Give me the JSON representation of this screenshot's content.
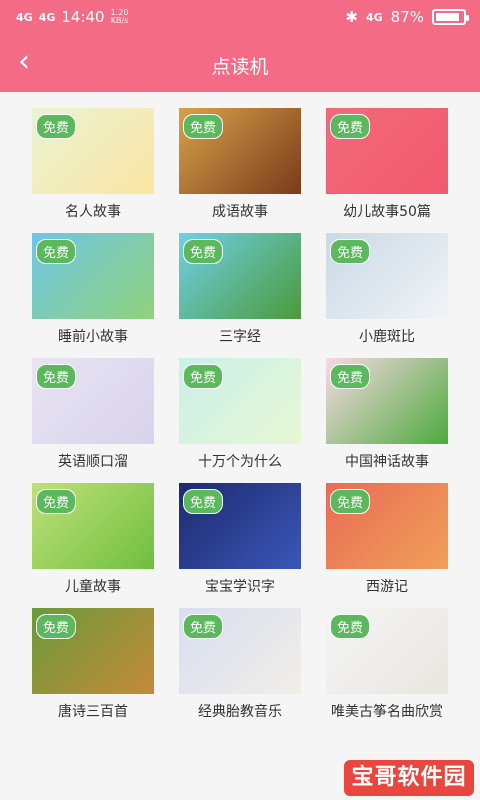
{
  "status_bar": {
    "network1": "4G",
    "network2": "4G",
    "time": "14:40",
    "speed_value": "1.20",
    "speed_unit": "KB/s",
    "network_right": "4G",
    "battery_text": "87%",
    "battery_level": 0.87
  },
  "nav": {
    "title": "点读机",
    "back_icon": "chevron-left-icon"
  },
  "items": [
    {
      "badge": "免费",
      "label": "名人故事",
      "bg1": "#eaf3d4",
      "bg2": "#fbe6a2"
    },
    {
      "badge": "免费",
      "label": "成语故事",
      "bg1": "#d8a24a",
      "bg2": "#7a3a1a"
    },
    {
      "badge": "免费",
      "label": "幼儿故事50篇",
      "bg1": "#f16a7a",
      "bg2": "#f25a6e"
    },
    {
      "badge": "免费",
      "label": "睡前小故事",
      "bg1": "#6fc5e6",
      "bg2": "#8fd27a"
    },
    {
      "badge": "免费",
      "label": "三字经",
      "bg1": "#6fd0e8",
      "bg2": "#4b9a3a"
    },
    {
      "badge": "免费",
      "label": "小鹿斑比",
      "bg1": "#c9d9e6",
      "bg2": "#f1f4f7"
    },
    {
      "badge": "免费",
      "label": "英语顺口溜",
      "bg1": "#e7e4f2",
      "bg2": "#d9d2ec"
    },
    {
      "badge": "免费",
      "label": "十万个为什么",
      "bg1": "#c9f0ea",
      "bg2": "#e8f7d4"
    },
    {
      "badge": "免费",
      "label": "中国神话故事",
      "bg1": "#f7d9e4",
      "bg2": "#4caa3c"
    },
    {
      "badge": "免费",
      "label": "儿童故事",
      "bg1": "#bfe07a",
      "bg2": "#6fbf3e"
    },
    {
      "badge": "免费",
      "label": "宝宝学识字",
      "bg1": "#1d2a6e",
      "bg2": "#3b57b8"
    },
    {
      "badge": "免费",
      "label": "西游记",
      "bg1": "#e96b55",
      "bg2": "#f0a05a"
    },
    {
      "badge": "免费",
      "label": "唐诗三百首",
      "bg1": "#6a9a3a",
      "bg2": "#c58a3a"
    },
    {
      "badge": "免费",
      "label": "经典胎教音乐",
      "bg1": "#d8dff0",
      "bg2": "#f2eee8"
    },
    {
      "badge": "免费",
      "label": "唯美古筝名曲欣赏",
      "bg1": "#f4f4f4",
      "bg2": "#e9e6e0"
    }
  ],
  "watermark": {
    "text": "宝哥软件园"
  }
}
